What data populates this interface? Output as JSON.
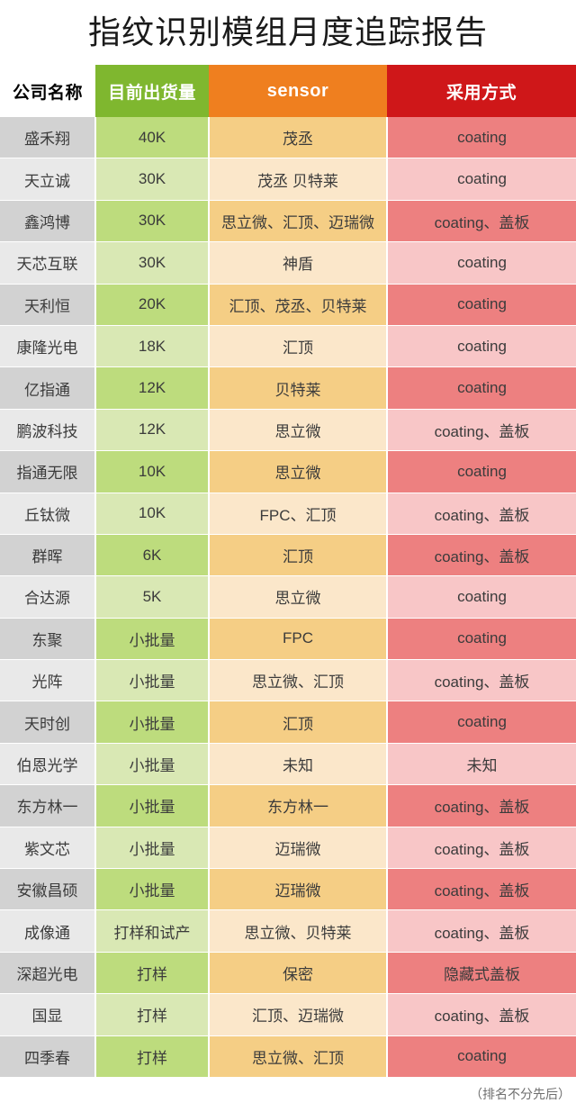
{
  "page": {
    "title": "指纹识别模组月度追踪报告",
    "footnote": "（排名不分先后）"
  },
  "colors": {
    "header_company_bg": "#ffffff",
    "header_company_text": "#000000",
    "header_volume_bg": "#7fb72f",
    "header_sensor_bg": "#ef7f1f",
    "header_method_bg": "#cf1719",
    "header_text": "#ffffff",
    "row_dark_company": "#d2d2d2",
    "row_dark_volume": "#bddc7d",
    "row_dark_sensor": "#f5ce85",
    "row_dark_method": "#ed8080",
    "row_light_company": "#e9e9e9",
    "row_light_volume": "#d9e8b4",
    "row_light_sensor": "#fbe7ca",
    "row_light_method": "#f8c6c7",
    "cell_text": "#3b3b3b",
    "footnote_text": "#6f6f6f"
  },
  "table": {
    "columns": [
      {
        "key": "company",
        "label": "公司名称"
      },
      {
        "key": "volume",
        "label": "目前出货量"
      },
      {
        "key": "sensor",
        "label": "sensor"
      },
      {
        "key": "method",
        "label": "采用方式"
      }
    ],
    "rows": [
      {
        "company": "盛禾翔",
        "volume": "40K",
        "sensor": "茂丞",
        "method": "coating"
      },
      {
        "company": "天立诚",
        "volume": "30K",
        "sensor": "茂丞 贝特莱",
        "method": "coating"
      },
      {
        "company": "鑫鸿博",
        "volume": "30K",
        "sensor": "思立微、汇顶、迈瑞微",
        "method": "coating、盖板"
      },
      {
        "company": "天芯互联",
        "volume": "30K",
        "sensor": "神盾",
        "method": "coating"
      },
      {
        "company": "天利恒",
        "volume": "20K",
        "sensor": "汇顶、茂丞、贝特莱",
        "method": "coating"
      },
      {
        "company": "康隆光电",
        "volume": "18K",
        "sensor": "汇顶",
        "method": "coating"
      },
      {
        "company": "亿指通",
        "volume": "12K",
        "sensor": "贝特莱",
        "method": "coating"
      },
      {
        "company": "鹏波科技",
        "volume": "12K",
        "sensor": "思立微",
        "method": "coating、盖板"
      },
      {
        "company": "指通无限",
        "volume": "10K",
        "sensor": "思立微",
        "method": "coating"
      },
      {
        "company": "丘钛微",
        "volume": "10K",
        "sensor": "FPC、汇顶",
        "method": "coating、盖板"
      },
      {
        "company": "群晖",
        "volume": "6K",
        "sensor": "汇顶",
        "method": "coating、盖板"
      },
      {
        "company": "合达源",
        "volume": "5K",
        "sensor": "思立微",
        "method": "coating"
      },
      {
        "company": "东聚",
        "volume": "小批量",
        "sensor": "FPC",
        "method": "coating"
      },
      {
        "company": "光阵",
        "volume": "小批量",
        "sensor": "思立微、汇顶",
        "method": "coating、盖板"
      },
      {
        "company": "天时创",
        "volume": "小批量",
        "sensor": "汇顶",
        "method": "coating"
      },
      {
        "company": "伯恩光学",
        "volume": "小批量",
        "sensor": "未知",
        "method": "未知"
      },
      {
        "company": "东方林一",
        "volume": "小批量",
        "sensor": "东方林一",
        "method": "coating、盖板"
      },
      {
        "company": "紫文芯",
        "volume": "小批量",
        "sensor": "迈瑞微",
        "method": "coating、盖板"
      },
      {
        "company": "安徽昌硕",
        "volume": "小批量",
        "sensor": "迈瑞微",
        "method": "coating、盖板"
      },
      {
        "company": "成像通",
        "volume": "打样和试产",
        "sensor": "思立微、贝特莱",
        "method": "coating、盖板"
      },
      {
        "company": "深超光电",
        "volume": "打样",
        "sensor": "保密",
        "method": "隐藏式盖板"
      },
      {
        "company": "国显",
        "volume": "打样",
        "sensor": "汇顶、迈瑞微",
        "method": "coating、盖板"
      },
      {
        "company": "四季春",
        "volume": "打样",
        "sensor": "思立微、汇顶",
        "method": "coating"
      }
    ]
  }
}
